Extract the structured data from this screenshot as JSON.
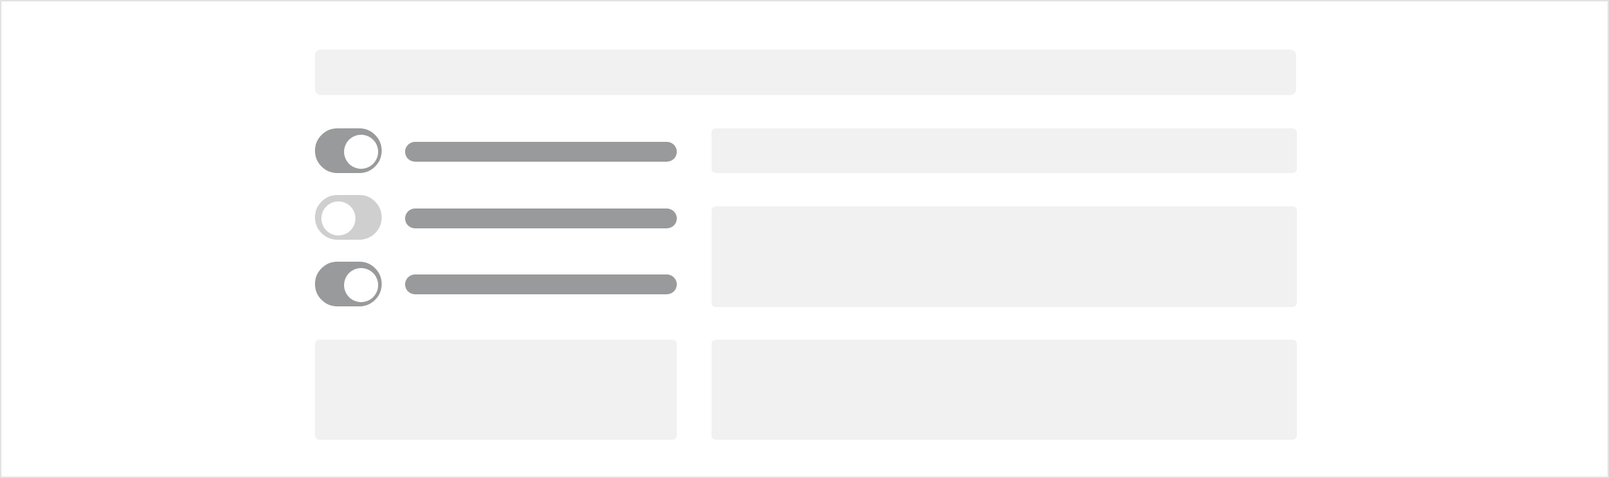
{
  "toggles": [
    {
      "state": "on"
    },
    {
      "state": "off"
    },
    {
      "state": "on"
    }
  ],
  "colors": {
    "placeholder": "#f1f1f1",
    "toggle_on": "#999a9b",
    "toggle_off": "#cfcfcf",
    "bar": "#999a9b",
    "frame_border": "#e3e3e3"
  }
}
